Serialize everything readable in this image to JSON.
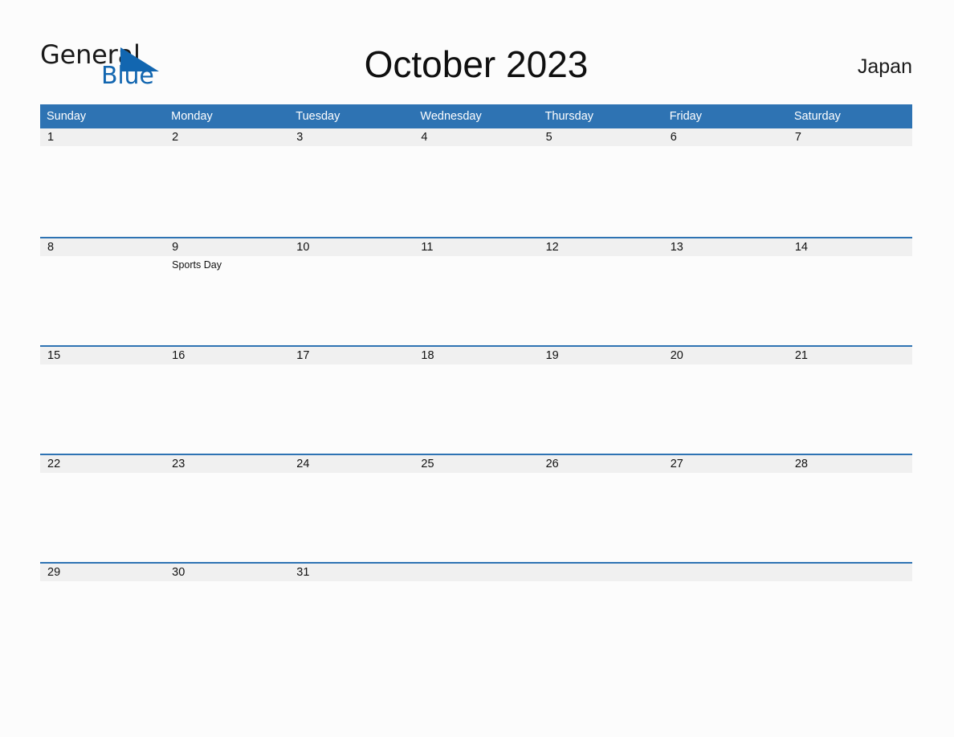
{
  "brand": {
    "logo_word_1": "General",
    "logo_word_2": "Blue",
    "logo_triangle_icon": "triangle-icon",
    "logo_dark_color": "#1a1a1a",
    "logo_blue_color": "#1266b0"
  },
  "header": {
    "title": "October 2023",
    "country": "Japan"
  },
  "colors": {
    "accent_blue": "#2e73b3",
    "daynum_band": "#f0f0f0",
    "page_background": "#fcfcfc",
    "header_text": "#ffffff",
    "body_text": "#111111"
  },
  "calendar": {
    "month": "October",
    "year": "2023",
    "region": "Japan",
    "weekday_headers": [
      "Sunday",
      "Monday",
      "Tuesday",
      "Wednesday",
      "Thursday",
      "Friday",
      "Saturday"
    ],
    "weeks": [
      {
        "days": [
          {
            "num": "1",
            "events": []
          },
          {
            "num": "2",
            "events": []
          },
          {
            "num": "3",
            "events": []
          },
          {
            "num": "4",
            "events": []
          },
          {
            "num": "5",
            "events": []
          },
          {
            "num": "6",
            "events": []
          },
          {
            "num": "7",
            "events": []
          }
        ]
      },
      {
        "days": [
          {
            "num": "8",
            "events": []
          },
          {
            "num": "9",
            "events": [
              "Sports Day"
            ]
          },
          {
            "num": "10",
            "events": []
          },
          {
            "num": "11",
            "events": []
          },
          {
            "num": "12",
            "events": []
          },
          {
            "num": "13",
            "events": []
          },
          {
            "num": "14",
            "events": []
          }
        ]
      },
      {
        "days": [
          {
            "num": "15",
            "events": []
          },
          {
            "num": "16",
            "events": []
          },
          {
            "num": "17",
            "events": []
          },
          {
            "num": "18",
            "events": []
          },
          {
            "num": "19",
            "events": []
          },
          {
            "num": "20",
            "events": []
          },
          {
            "num": "21",
            "events": []
          }
        ]
      },
      {
        "days": [
          {
            "num": "22",
            "events": []
          },
          {
            "num": "23",
            "events": []
          },
          {
            "num": "24",
            "events": []
          },
          {
            "num": "25",
            "events": []
          },
          {
            "num": "26",
            "events": []
          },
          {
            "num": "27",
            "events": []
          },
          {
            "num": "28",
            "events": []
          }
        ]
      },
      {
        "days": [
          {
            "num": "29",
            "events": []
          },
          {
            "num": "30",
            "events": []
          },
          {
            "num": "31",
            "events": []
          },
          {
            "num": "",
            "events": []
          },
          {
            "num": "",
            "events": []
          },
          {
            "num": "",
            "events": []
          },
          {
            "num": "",
            "events": []
          }
        ]
      }
    ]
  }
}
